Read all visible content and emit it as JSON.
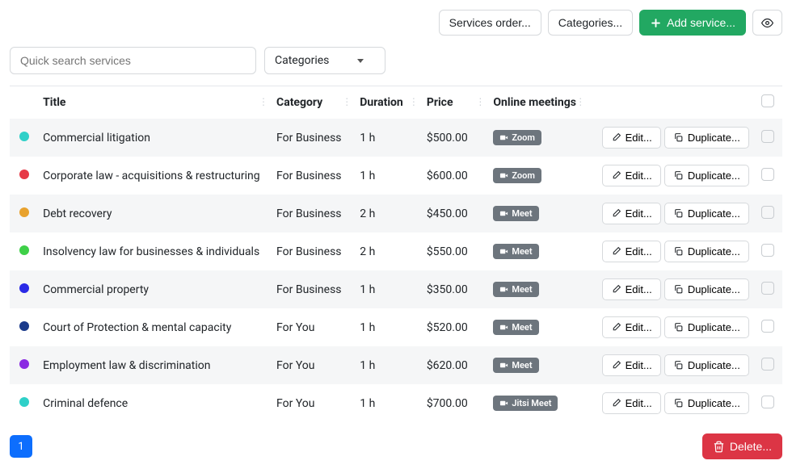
{
  "toolbar": {
    "services_order": "Services order...",
    "categories": "Categories...",
    "add_service": "Add service..."
  },
  "filters": {
    "search_placeholder": "Quick search services",
    "category_label": "Categories"
  },
  "headers": {
    "title": "Title",
    "category": "Category",
    "duration": "Duration",
    "price": "Price",
    "online": "Online meetings"
  },
  "row_actions": {
    "edit": "Edit...",
    "duplicate": "Duplicate..."
  },
  "rows": [
    {
      "color": "#2fd0c8",
      "title": "Commercial litigation",
      "category": "For Business",
      "duration": "1 h",
      "price": "$500.00",
      "online": "Zoom"
    },
    {
      "color": "#e63946",
      "title": "Corporate law - acquisitions & restructuring",
      "category": "For Business",
      "duration": "1 h",
      "price": "$600.00",
      "online": "Zoom"
    },
    {
      "color": "#e8a22e",
      "title": "Debt recovery",
      "category": "For Business",
      "duration": "2 h",
      "price": "$450.00",
      "online": "Meet"
    },
    {
      "color": "#3ed048",
      "title": "Insolvency law for businesses & individuals",
      "category": "For Business",
      "duration": "2 h",
      "price": "$550.00",
      "online": "Meet"
    },
    {
      "color": "#2a2ae6",
      "title": "Commercial property",
      "category": "For Business",
      "duration": "1 h",
      "price": "$350.00",
      "online": "Meet"
    },
    {
      "color": "#1a3a8a",
      "title": "Court of Protection & mental capacity",
      "category": "For You",
      "duration": "1 h",
      "price": "$520.00",
      "online": "Meet"
    },
    {
      "color": "#8a2be2",
      "title": "Employment law & discrimination",
      "category": "For You",
      "duration": "1 h",
      "price": "$620.00",
      "online": "Meet"
    },
    {
      "color": "#2fd0c8",
      "title": "Criminal defence",
      "category": "For You",
      "duration": "1 h",
      "price": "$700.00",
      "online": "Jitsi Meet"
    }
  ],
  "footer": {
    "page": "1",
    "delete": "Delete..."
  }
}
